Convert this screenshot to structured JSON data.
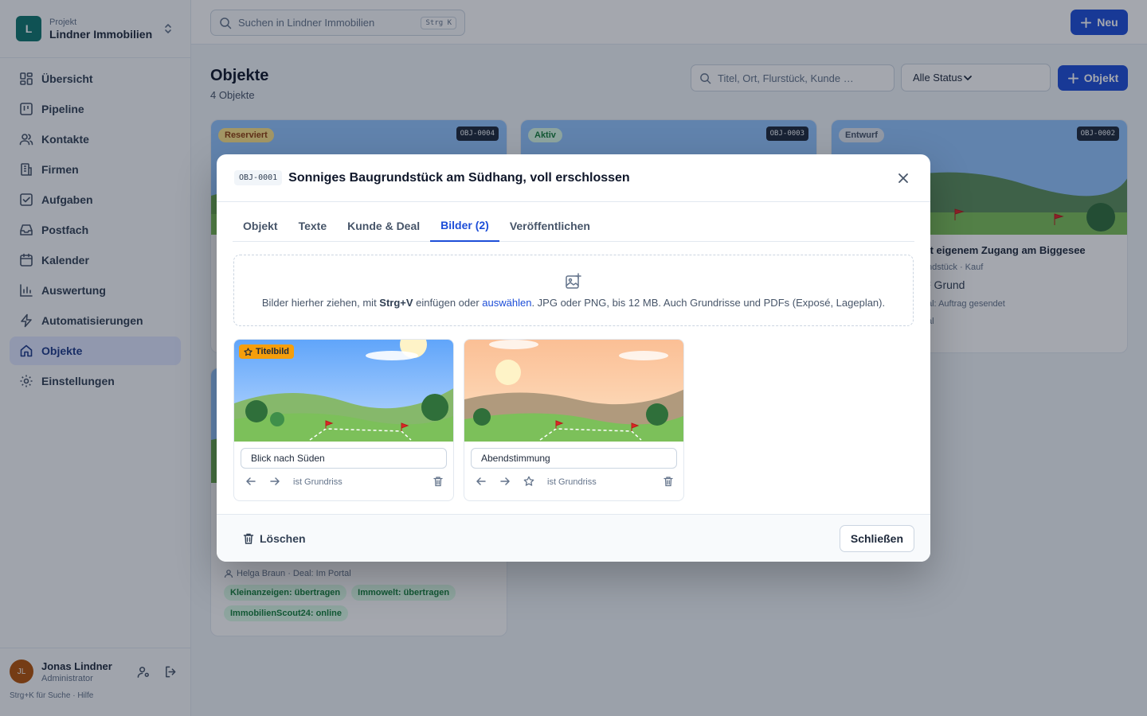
{
  "project": {
    "label": "Projekt",
    "name": "Lindner Immobilien",
    "initial": "L"
  },
  "nav": [
    {
      "label": "Übersicht",
      "icon": "dashboard-icon"
    },
    {
      "label": "Pipeline",
      "icon": "pipeline-icon"
    },
    {
      "label": "Kontakte",
      "icon": "contacts-icon"
    },
    {
      "label": "Firmen",
      "icon": "building-icon"
    },
    {
      "label": "Aufgaben",
      "icon": "task-icon"
    },
    {
      "label": "Postfach",
      "icon": "inbox-icon"
    },
    {
      "label": "Kalender",
      "icon": "calendar-icon"
    },
    {
      "label": "Auswertung",
      "icon": "chart-icon"
    },
    {
      "label": "Automatisierungen",
      "icon": "bolt-icon"
    },
    {
      "label": "Objekte",
      "icon": "home-icon",
      "active": true
    },
    {
      "label": "Einstellungen",
      "icon": "gear-icon"
    }
  ],
  "user": {
    "initials": "JL",
    "name": "Jonas Lindner",
    "role": "Administrator",
    "hint": "Strg+K für Suche · Hilfe"
  },
  "topbar": {
    "search_placeholder": "Suchen in Lindner Immobilien",
    "search_kbd": "Strg K",
    "new_label": "Neu"
  },
  "page": {
    "title": "Objekte",
    "count": "4 Objekte",
    "filter_placeholder": "Titel, Ort, Flurstück, Kunde …",
    "status_select": "Alle Status",
    "add_label": "Objekt"
  },
  "cards": [
    {
      "status": "Reserviert",
      "id": "OBJ-0004"
    },
    {
      "status": "Aktiv",
      "id": "OBJ-0003"
    },
    {
      "status": "Entwurf",
      "id": "OBJ-0002",
      "title_fragment": "it eigenem Zugang am Biggesee",
      "meta_fragment": "ndstück · Kauf",
      "size_fragment": "² Grund",
      "line_fragment": "al: Auftrag gesendet",
      "extra_fragment": "al"
    }
  ],
  "bottom_card": {
    "owner": "Helga Braun · Deal: Im Portal",
    "tags": [
      "Kleinanzeigen: übertragen",
      "Immowelt: übertragen",
      "ImmobilienScout24: online"
    ]
  },
  "modal": {
    "obj_id": "OBJ-0001",
    "title": "Sonniges Baugrundstück am Südhang, voll erschlossen",
    "tabs": [
      "Objekt",
      "Texte",
      "Kunde & Deal",
      "Bilder (2)",
      "Veröffentlichen"
    ],
    "active_tab": "Bilder (2)",
    "dropzone": {
      "pre": "Bilder hierher ziehen, mit ",
      "kbd": "Strg+V",
      "mid": " einfügen oder ",
      "link": "auswählen",
      "post": ". JPG oder PNG, bis 12 MB. Auch Grundrisse und PDFs (Exposé, Lageplan)."
    },
    "images": [
      {
        "caption": "Blick nach Süden",
        "badge": "Titelbild",
        "floorplan_label": "ist Grundriss"
      },
      {
        "caption": "Abendstimmung",
        "floorplan_label": "ist Grundriss"
      }
    ],
    "delete_label": "Löschen",
    "close_label": "Schließen"
  },
  "colors": {
    "accent": "#1d4ed8",
    "sidebar_active": "#e0e7ff",
    "overlay": "rgba(15,23,42,0.38)"
  }
}
